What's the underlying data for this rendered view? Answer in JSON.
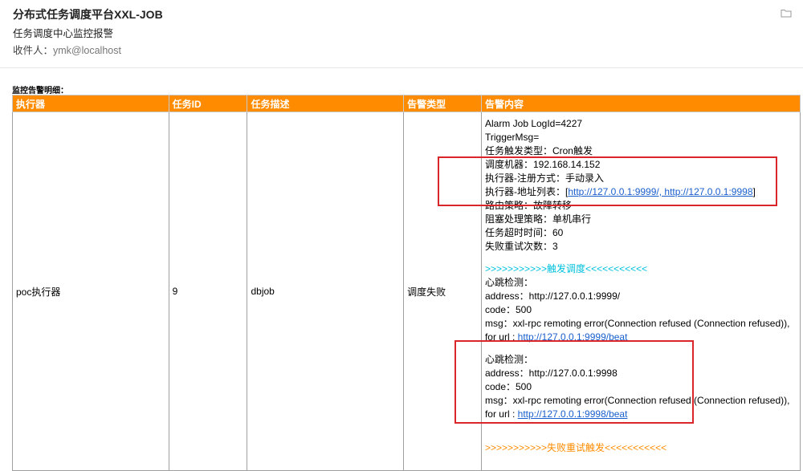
{
  "mail": {
    "title": "分布式任务调度平台XXL-JOB",
    "folder": "",
    "subject": "任务调度中心监控报警",
    "recipient_label": "收件人：",
    "recipient": "ymk@localhost"
  },
  "detail_heading": "监控告警明细：",
  "table": {
    "headers": [
      "执行器",
      "任务ID",
      "任务描述",
      "告警类型",
      "告警内容"
    ],
    "row": {
      "executor": "poc执行器",
      "job_id": "9",
      "job_desc": "dbjob",
      "alarm_type": "调度失败"
    },
    "content": {
      "alarm_job": "Alarm Job LogId=4227",
      "trigger_msg": "TriggerMsg=",
      "trigger_type": "任务触发类型：Cron触发",
      "machine": "调度机器：192.168.14.152",
      "reg_type": "执行器-注册方式：手动录入",
      "addr_prefix": "执行器-地址列表：[",
      "addr_link": "http://127.0.0.1:9999/, http://127.0.0.1:9998",
      "addr_suffix": "]",
      "route": "路由策略：故障转移",
      "block": "阻塞处理策略：单机串行",
      "timeout": "任务超时时间：60",
      "retry_count": "失败重试次数：3",
      "trigger_section": ">>>>>>>>>>>触发调度<<<<<<<<<<<",
      "beats": [
        {
          "title": "心跳检测：",
          "address": "address：http://127.0.0.1:9999/",
          "code": "code：500",
          "msg": "msg：xxl-rpc remoting error(Connection refused (Connection refused)),",
          "url_prefix": "for url : ",
          "url": "http://127.0.0.1:9999/beat"
        },
        {
          "title": "心跳检测：",
          "address": "address：http://127.0.0.1:9998",
          "code": "code：500",
          "msg": "msg：xxl-rpc remoting error(Connection refused (Connection refused)),",
          "url_prefix": "for url : ",
          "url": "http://127.0.0.1:9998/beat"
        }
      ],
      "retry_section": ">>>>>>>>>>>失败重试触发<<<<<<<<<<<"
    }
  },
  "colors": {
    "header_bg": "#ff8c00",
    "trigger_section": "#00c1de",
    "retry_section": "#ff8c00",
    "highlight_box": "#d9262b",
    "link": "#1a5fcc"
  }
}
